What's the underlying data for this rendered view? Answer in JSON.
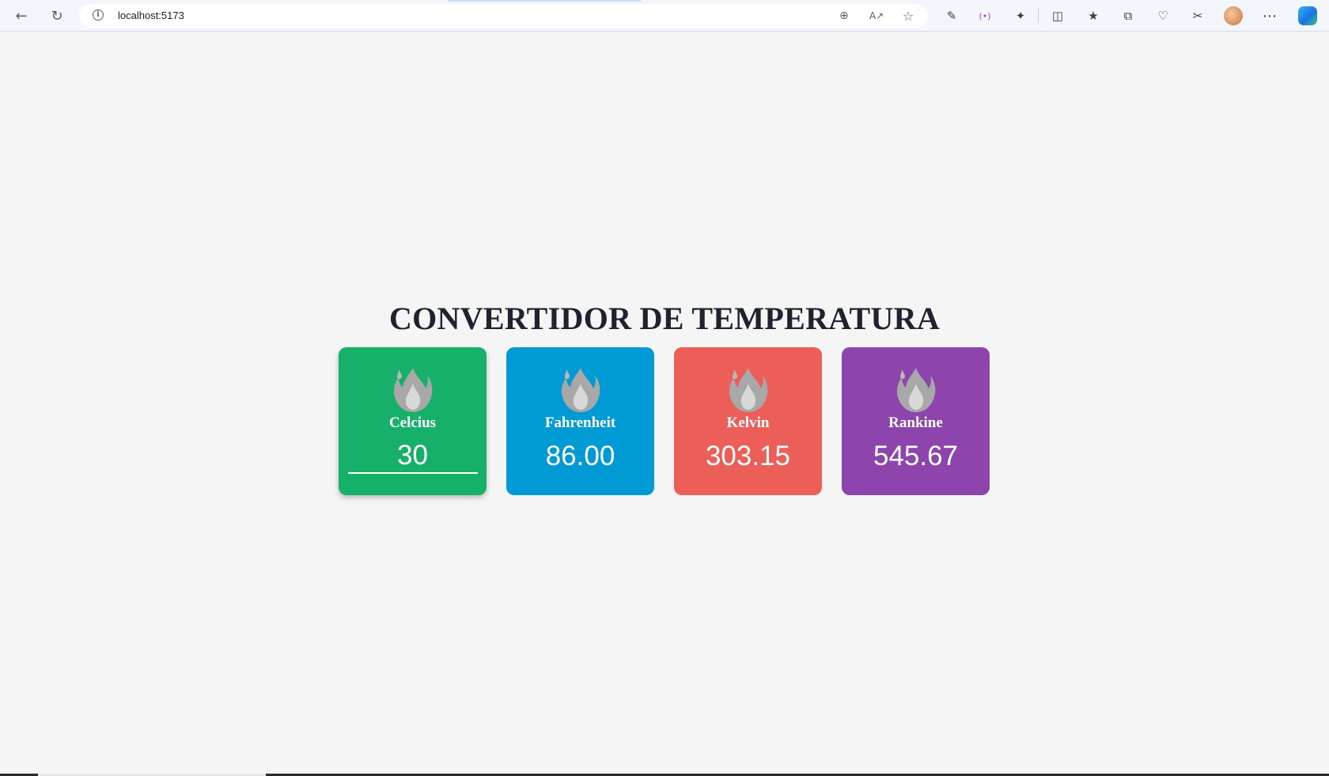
{
  "browser": {
    "url": "localhost:5173",
    "icons": {
      "back": "back-arrow-icon",
      "refresh": "refresh-icon",
      "info": "info-icon",
      "zoom": "zoom-in-icon",
      "read_aloud": "read-aloud-icon",
      "favorite": "star-icon",
      "extensions": [
        "pen-extension-icon",
        "broadcast-icon",
        "puzzle-icon",
        "split-screen-icon",
        "favorites-icon",
        "collections-icon",
        "health-icon",
        "screenshot-icon"
      ],
      "more": "more-dots-icon",
      "copilot": "copilot-icon"
    }
  },
  "page": {
    "title": "CONVERTIDOR DE TEMPERATURA",
    "cards": [
      {
        "label": "Celcius",
        "value": "30",
        "color": "#17b06b",
        "editable": true
      },
      {
        "label": "Fahrenheit",
        "value": "86.00",
        "color": "#009bd5",
        "editable": false
      },
      {
        "label": "Kelvin",
        "value": "303.15",
        "color": "#ec5f59",
        "editable": false
      },
      {
        "label": "Rankine",
        "value": "545.67",
        "color": "#8e44ad",
        "editable": false
      }
    ]
  }
}
